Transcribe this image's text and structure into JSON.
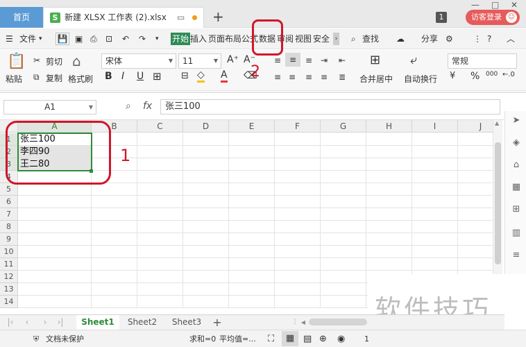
{
  "tabs": {
    "home": "首页",
    "file_name": "新建 XLSX 工作表 (2).xlsx"
  },
  "title_right": {
    "count": "1",
    "login": "访客登录",
    "avatar": "☺"
  },
  "menu": {
    "file": "文件",
    "items": [
      "开始",
      "插入",
      "页面布局",
      "公式",
      "数据",
      "审阅",
      "视图",
      "安全"
    ],
    "find": "查找",
    "share": "分享"
  },
  "ribbon": {
    "paste": "粘贴",
    "cut": "剪切",
    "copy": "复制",
    "format_painter": "格式刷",
    "font_name": "宋体",
    "font_size": "11",
    "merge_center": "合并居中",
    "auto_wrap": "自动换行",
    "number_format": "常规",
    "percent": "%",
    "thousands": "000"
  },
  "formula": {
    "cell_ref": "A1",
    "fx": "fx",
    "content": "张三100"
  },
  "grid": {
    "columns": [
      "A",
      "B",
      "C",
      "D",
      "E",
      "F",
      "G",
      "H",
      "I",
      "J"
    ],
    "rows": [
      "1",
      "2",
      "3",
      "4",
      "5",
      "6",
      "7",
      "8",
      "9",
      "10",
      "11",
      "12",
      "13",
      "14"
    ],
    "cells": {
      "A1": "张三100",
      "A2": "李四90",
      "A3": "王二80"
    }
  },
  "annotations": {
    "label1": "1",
    "label2": "2",
    "color": "#d0162a"
  },
  "sheets": [
    "Sheet1",
    "Sheet2",
    "Sheet3"
  ],
  "status": {
    "protect": "文档未保护",
    "sum": "求和=0",
    "avg": "平均值=...",
    "zoom": "1"
  },
  "watermark": "软件技巧"
}
